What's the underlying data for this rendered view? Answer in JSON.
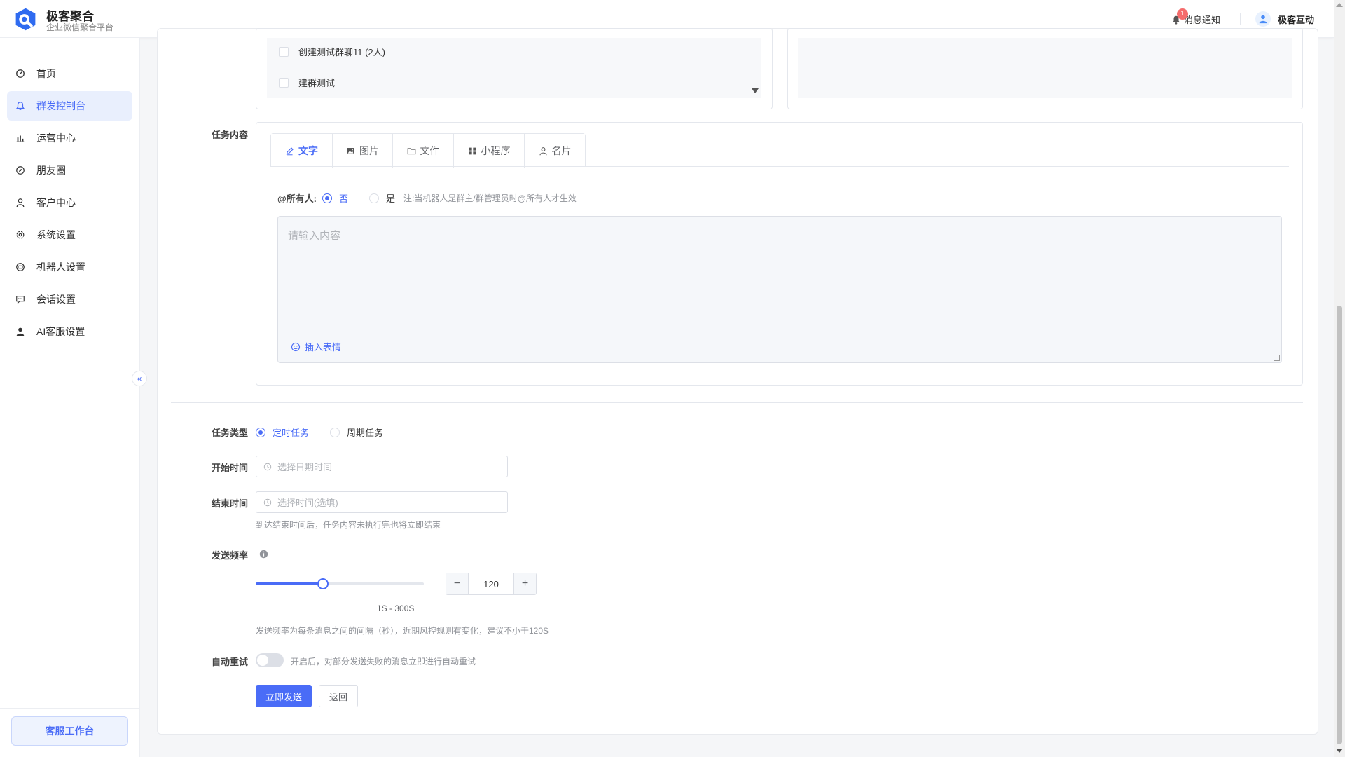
{
  "brand": {
    "name": "极客聚合",
    "subtitle": "企业微信聚合平台"
  },
  "header": {
    "notification_label": "消息通知",
    "notification_count": "1",
    "user_name": "极客互动"
  },
  "sidebar": {
    "items": [
      {
        "label": "首页",
        "icon": "dashboard-icon"
      },
      {
        "label": "群发控制台",
        "icon": "bell-icon"
      },
      {
        "label": "运营中心",
        "icon": "chart-icon"
      },
      {
        "label": "朋友圈",
        "icon": "compass-icon"
      },
      {
        "label": "客户中心",
        "icon": "user-icon"
      },
      {
        "label": "系统设置",
        "icon": "gear-icon"
      },
      {
        "label": "机器人设置",
        "icon": "robot-icon"
      },
      {
        "label": "会话设置",
        "icon": "chat-icon"
      },
      {
        "label": "AI客服设置",
        "icon": "person-icon"
      }
    ],
    "active_index": 1,
    "collapse_icon": "«",
    "workbench_label": "客服工作台"
  },
  "groups": {
    "items": [
      "创建测试群聊11 (2人)",
      "建群测试"
    ]
  },
  "task_content": {
    "label": "任务内容",
    "tabs": [
      {
        "label": "文字",
        "icon": "pen-icon"
      },
      {
        "label": "图片",
        "icon": "image-icon"
      },
      {
        "label": "文件",
        "icon": "folder-icon"
      },
      {
        "label": "小程序",
        "icon": "grid-icon"
      },
      {
        "label": "名片",
        "icon": "card-icon"
      }
    ],
    "mention_all_label": "@所有人:",
    "mention_no": "否",
    "mention_yes": "是",
    "mention_note": "注:当机器人是群主/群管理员时@所有人才生效",
    "textarea_placeholder": "请输入内容",
    "emoji_label": "插入表情"
  },
  "task_type": {
    "label": "任务类型",
    "option_scheduled": "定时任务",
    "option_periodic": "周期任务",
    "selected": "定时任务"
  },
  "start_time": {
    "label": "开始时间",
    "placeholder": "选择日期时间"
  },
  "end_time": {
    "label": "结束时间",
    "placeholder": "选择时间(选填)",
    "hint": "到达结束时间后，任务内容未执行完也将立即结束"
  },
  "frequency": {
    "label": "发送频率",
    "value": "120",
    "min": 1,
    "max": 300,
    "range_label": "1S - 300S",
    "hint": "发送频率为每条消息之间的间隔（秒），近期风控规则有变化，建议不小于120S",
    "minus": "−",
    "plus": "+"
  },
  "auto_retry": {
    "label": "自动重试",
    "enabled": false,
    "hint": "开启后，对部分发送失败的消息立即进行自动重试"
  },
  "actions": {
    "send_now": "立即发送",
    "back": "返回"
  },
  "colors": {
    "accent": "#4a6cf7",
    "badge": "#f56c6c"
  }
}
